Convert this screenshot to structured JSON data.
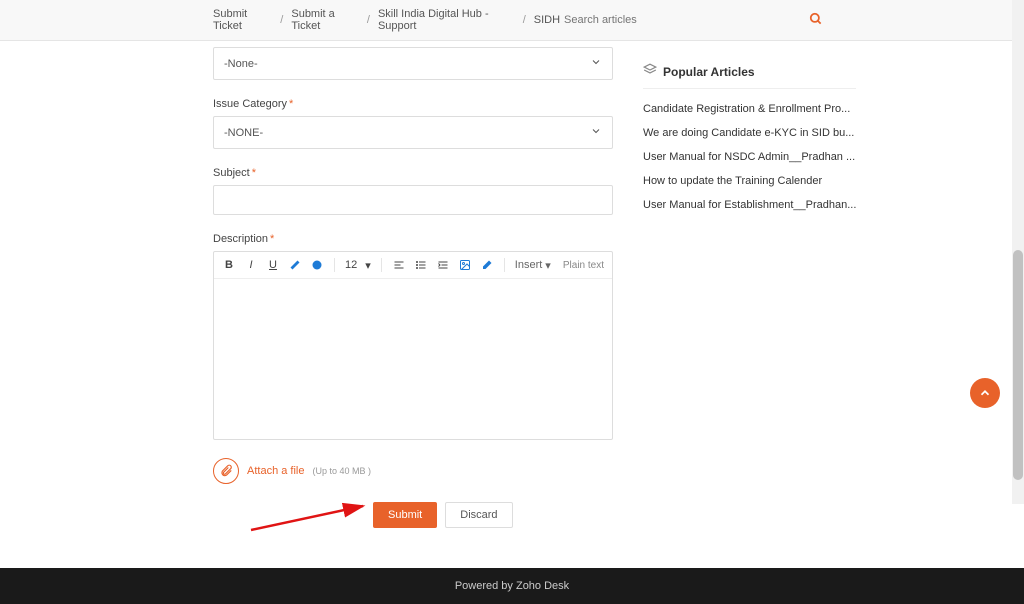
{
  "breadcrumb": {
    "a": "Submit Ticket",
    "b": "Submit a Ticket",
    "c": "Skill India Digital Hub - Support",
    "d": "SIDH"
  },
  "search": {
    "placeholder": "Search articles"
  },
  "fields": {
    "topSelect": {
      "value": "-None-"
    },
    "issueCategory": {
      "label": "Issue Category",
      "value": "-NONE-"
    },
    "subject": {
      "label": "Subject"
    },
    "description": {
      "label": "Description"
    }
  },
  "editor": {
    "fontSize": "12",
    "insertLabel": "Insert",
    "plainText": "Plain text"
  },
  "attach": {
    "label": "Attach a file",
    "hint": "(Up to 40 MB )"
  },
  "buttons": {
    "submit": "Submit",
    "discard": "Discard"
  },
  "popular": {
    "title": "Popular Articles",
    "items": [
      "Candidate Registration & Enrollment Pro...",
      "We are doing Candidate e-KYC in SID bu...",
      "User Manual for NSDC Admin__Pradhan ...",
      "How to update the Training Calender",
      "User Manual for Establishment__Pradhan..."
    ]
  },
  "footer": {
    "text": "Powered by Zoho Desk"
  }
}
